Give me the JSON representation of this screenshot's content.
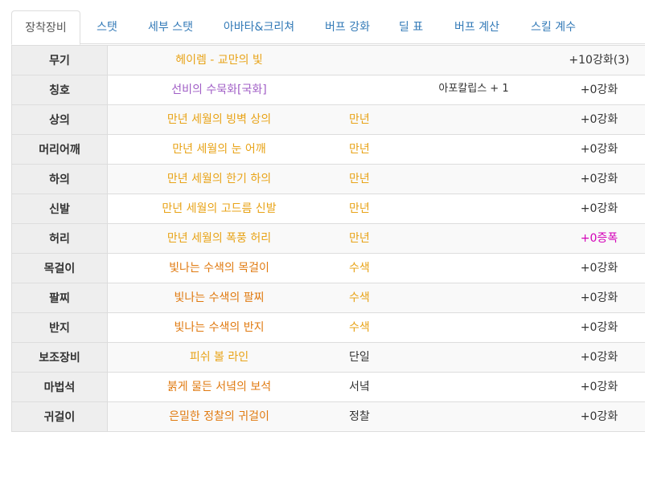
{
  "tabs": [
    {
      "label": "장착장비",
      "active": true
    },
    {
      "label": "스탯"
    },
    {
      "label": "세부 스탯"
    },
    {
      "label": "아바타&크리쳐"
    },
    {
      "label": "버프 강화"
    },
    {
      "label": "딜 표"
    },
    {
      "label": "버프 계산"
    },
    {
      "label": "스킬 계수"
    }
  ],
  "equipment": [
    {
      "slot": "무기",
      "item": "헤이렘 - 교만의 빛",
      "item_color": "#e8a317",
      "set": "",
      "extra": "",
      "enhance": "+10강화(3)",
      "enhance_color": "#333333"
    },
    {
      "slot": "칭호",
      "item": "선비의 수묵화[국화]",
      "item_color": "#a05ec6",
      "set": "",
      "extra": "아포칼립스 + 1",
      "enhance": "+0강화",
      "enhance_color": "#333333"
    },
    {
      "slot": "상의",
      "item": "만년 세월의 빙벽 상의",
      "item_color": "#e8a317",
      "set": "만년",
      "set_color": "#e8a317",
      "extra": "",
      "enhance": "+0강화",
      "enhance_color": "#333333"
    },
    {
      "slot": "머리어깨",
      "item": "만년 세월의 눈 어깨",
      "item_color": "#e8a317",
      "set": "만년",
      "set_color": "#e8a317",
      "extra": "",
      "enhance": "+0강화",
      "enhance_color": "#333333"
    },
    {
      "slot": "하의",
      "item": "만년 세월의 한기 하의",
      "item_color": "#e8a317",
      "set": "만년",
      "set_color": "#e8a317",
      "extra": "",
      "enhance": "+0강화",
      "enhance_color": "#333333"
    },
    {
      "slot": "신발",
      "item": "만년 세월의 고드름 신발",
      "item_color": "#e8a317",
      "set": "만년",
      "set_color": "#e8a317",
      "extra": "",
      "enhance": "+0강화",
      "enhance_color": "#333333"
    },
    {
      "slot": "허리",
      "item": "만년 세월의 폭풍 허리",
      "item_color": "#e8a317",
      "set": "만년",
      "set_color": "#e8a317",
      "extra": "",
      "enhance": "+0증폭",
      "enhance_color": "#d400b8"
    },
    {
      "slot": "목걸이",
      "item": "빛나는 수색의 목걸이",
      "item_color": "#e07a10",
      "set": "수색",
      "set_color": "#e8a317",
      "extra": "",
      "enhance": "+0강화",
      "enhance_color": "#333333"
    },
    {
      "slot": "팔찌",
      "item": "빛나는 수색의 팔찌",
      "item_color": "#e07a10",
      "set": "수색",
      "set_color": "#e8a317",
      "extra": "",
      "enhance": "+0강화",
      "enhance_color": "#333333"
    },
    {
      "slot": "반지",
      "item": "빛나는 수색의 반지",
      "item_color": "#e07a10",
      "set": "수색",
      "set_color": "#e8a317",
      "extra": "",
      "enhance": "+0강화",
      "enhance_color": "#333333"
    },
    {
      "slot": "보조장비",
      "item": "피쉬 볼 라인",
      "item_color": "#e8a317",
      "set": "단일",
      "set_color": "#333333",
      "extra": "",
      "enhance": "+0강화",
      "enhance_color": "#333333"
    },
    {
      "slot": "마법석",
      "item": "붉게 물든 서녘의 보석",
      "item_color": "#e07a10",
      "set": "서녘",
      "set_color": "#333333",
      "extra": "",
      "enhance": "+0강화",
      "enhance_color": "#333333"
    },
    {
      "slot": "귀걸이",
      "item": "은밀한 정찰의 귀걸이",
      "item_color": "#e07a10",
      "set": "정찰",
      "set_color": "#333333",
      "extra": "",
      "enhance": "+0강화",
      "enhance_color": "#333333"
    }
  ]
}
